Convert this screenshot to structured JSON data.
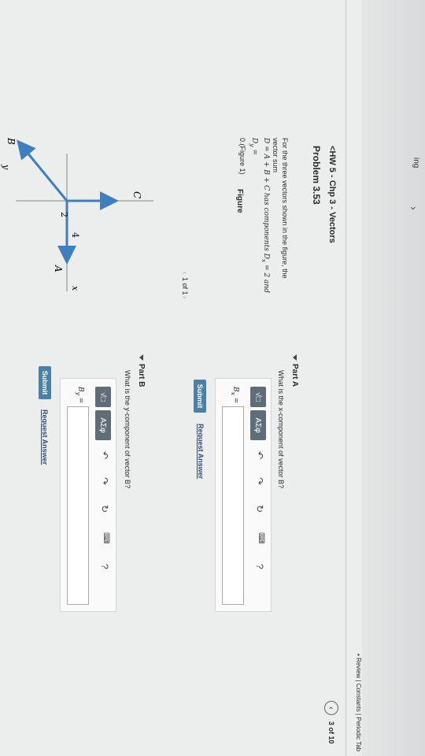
{
  "nav": {
    "back_icon": "chevron-left-icon",
    "assignment_title": "<HW 5 - Chp 3 - Vectors",
    "problem_title": "Problem 3.53",
    "side_cut_label": "ing",
    "side_arrow": "›",
    "prev_icon": "chevron-left-circle-icon",
    "page_count": "3 of 10",
    "review_links": "Review | Constants | Periodic Tab"
  },
  "problem": {
    "text_line1": "For the three vectors shown in the figure, the vector sum",
    "text_line2": "D = A + B + C has components D",
    "text_line3": "= 2 and D",
    "text_line4": "=",
    "text_line5": "0.(Figure 1)"
  },
  "figure": {
    "label": "Figure",
    "pager": "1 of 1",
    "axis_y": "y",
    "axis_x": "x",
    "vec_B": "B",
    "vec_C": "C",
    "vec_A": "A",
    "len_2": "2",
    "len_4": "4"
  },
  "partA": {
    "title": "Part A",
    "question": "What is the x-component of vector B?",
    "input_label": "B",
    "input_sub": "x",
    "input_value": "",
    "tool_matrix": "√□",
    "tool_greek": "ΑΣφ",
    "submit": "Submit",
    "request": "Request Answer"
  },
  "partB": {
    "title": "Part B",
    "question": "What is the y-component of vector B?",
    "input_label": "B",
    "input_sub": "y",
    "input_value": "",
    "tool_matrix": "√□",
    "tool_greek": "ΑΣφ",
    "submit": "Submit",
    "request": "Request Answer"
  },
  "colors": {
    "accent": "#4a7fa6",
    "vector": "#3d7fc0",
    "toolbar": "#5e6d77"
  }
}
